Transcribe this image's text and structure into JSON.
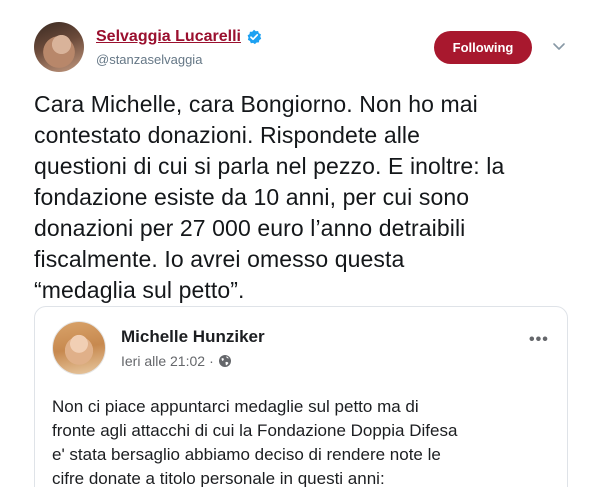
{
  "tweet": {
    "display_name": "Selvaggia Lucarelli",
    "handle": "@stanzaselvaggia",
    "follow_label": "Following",
    "text": "Cara Michelle, cara Bongiorno. Non ho mai\ncontestato donazioni. Rispondete alle\nquestioni di cui si parla nel pezzo. E inoltre: la\nfondazione esiste da 10 anni, per cui sono\ndonazioni per 27 000 euro l’anno detraibili\nfiscalmente. Io avrei omesso questa\n“medaglia sul petto”."
  },
  "embedded_post": {
    "author": "Michelle Hunziker",
    "timestamp": "Ieri alle 21:02",
    "separator": "·",
    "more": "•••",
    "text": "Non ci piace appuntarci medaglie sul petto ma di\nfronte agli attacchi di cui la Fondazione Doppia Difesa\ne' stata bersaglio abbiamo deciso di rendere note le\ncifre  donate a titolo personale in questi anni:"
  },
  "colors": {
    "name": "#9a0f2e",
    "follow_button": "#a8182e",
    "verified": "#1da1f2",
    "muted": "#657786"
  },
  "icons": {
    "verified": "verified-badge-icon",
    "chevron": "chevron-down-icon",
    "globe": "globe-icon"
  }
}
